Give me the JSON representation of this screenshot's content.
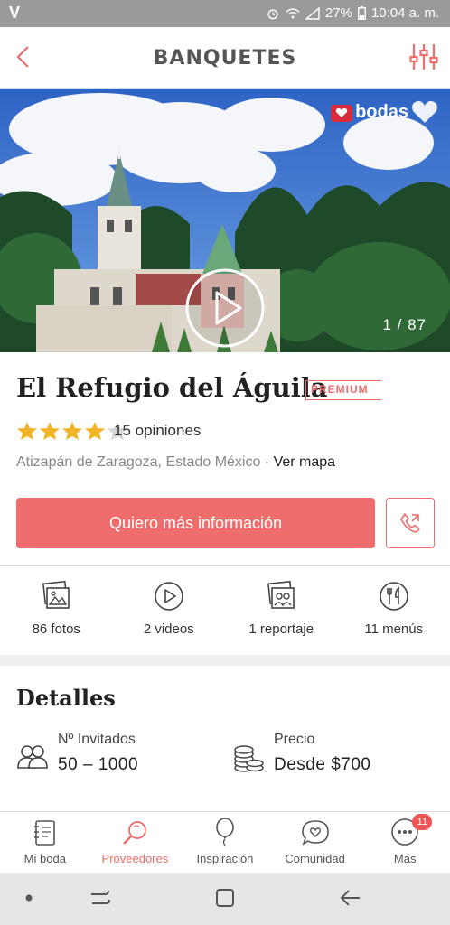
{
  "status_bar": {
    "carrier": "V",
    "battery": "27%",
    "time": "10:04 a. m."
  },
  "header": {
    "title": "BANQUETES"
  },
  "hero": {
    "counter": "1 / 87",
    "brand": "bodas"
  },
  "venue": {
    "name": "El Refugio del Águila",
    "badge": "PREMIUM",
    "rating": 4,
    "rating_max": 5,
    "reviews": "15 opiniones",
    "location": "Atizapán de Zaragoza, Estado México",
    "separator": " · ",
    "map_link": "Ver mapa"
  },
  "actions": {
    "cta": "Quiero más información"
  },
  "media": [
    {
      "label": "86 fotos",
      "icon": "photos-icon"
    },
    {
      "label": "2 videos",
      "icon": "video-icon"
    },
    {
      "label": "1 reportaje",
      "icon": "report-icon"
    },
    {
      "label": "11 menús",
      "icon": "menu-icon"
    }
  ],
  "details": {
    "title": "Detalles",
    "guests_label": "Nº Invitados",
    "guests_value": "50 – 1000",
    "price_label": "Precio",
    "price_value": "Desde $700"
  },
  "bottom_nav": [
    {
      "label": "Mi boda",
      "icon": "notebook-icon",
      "active": false
    },
    {
      "label": "Proveedores",
      "icon": "search-icon",
      "active": true
    },
    {
      "label": "Inspiración",
      "icon": "balloon-icon",
      "active": false
    },
    {
      "label": "Comunidad",
      "icon": "chat-heart-icon",
      "active": false
    },
    {
      "label": "Más",
      "icon": "more-icon",
      "active": false,
      "badge": "11"
    }
  ],
  "colors": {
    "accent": "#ef6d6d",
    "status_bar": "#9a9a9a",
    "star": "#f0b429"
  }
}
